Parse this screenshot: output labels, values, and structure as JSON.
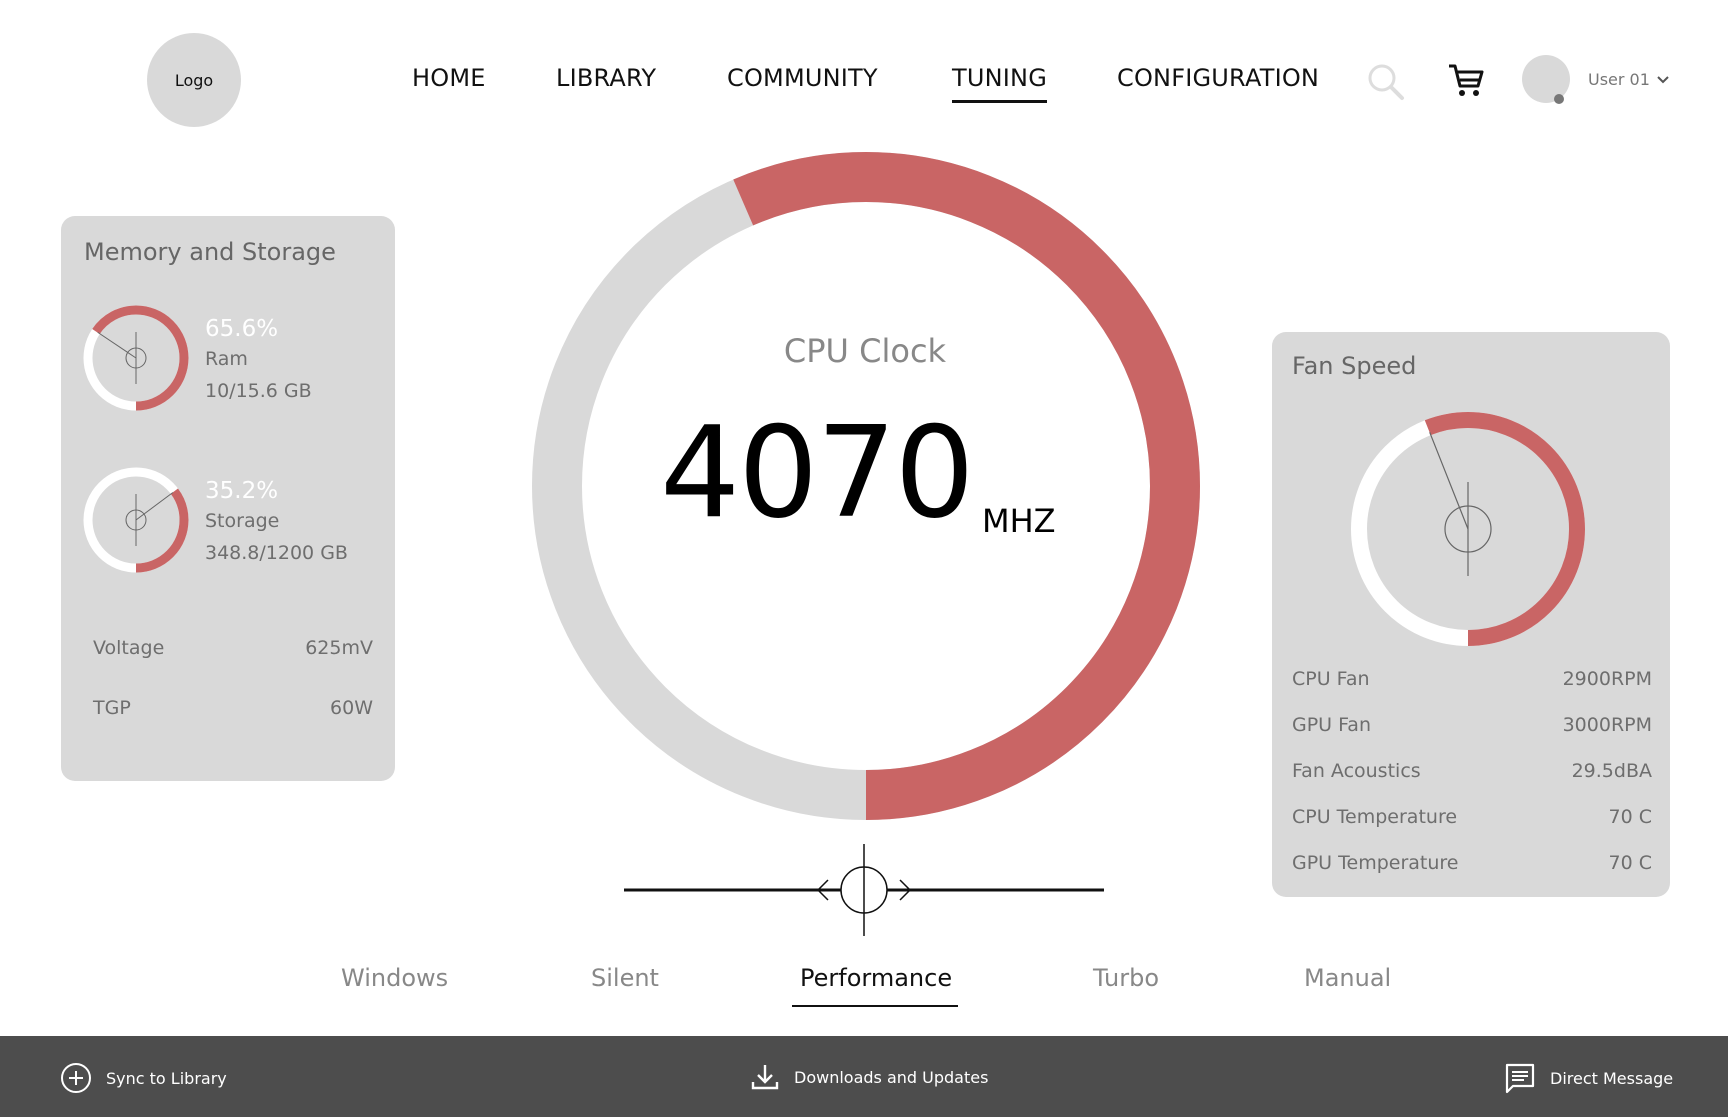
{
  "header": {
    "logo_text": "Logo",
    "nav": [
      {
        "label": "HOME"
      },
      {
        "label": "LIBRARY"
      },
      {
        "label": "COMMUNITY"
      },
      {
        "label": "TUNING"
      },
      {
        "label": "CONFIGURATION"
      }
    ],
    "active_nav": "TUNING",
    "user_name": "User 01"
  },
  "memory": {
    "title": "Memory and Storage",
    "ram": {
      "percent_text": "65.6%",
      "label": "Ram",
      "usage": "10/15.6 GB",
      "fraction": 0.656
    },
    "storage": {
      "percent_text": "35.2%",
      "label": "Storage",
      "usage": "348.8/1200 GB",
      "fraction": 0.352
    },
    "voltage": {
      "label": "Voltage",
      "value": "625mV"
    },
    "tgp": {
      "label": "TGP",
      "value": "60W"
    }
  },
  "cpu": {
    "title": "CPU Clock",
    "value": "4070",
    "unit": "MHZ",
    "fraction": 0.565
  },
  "fan": {
    "title": "Fan Speed",
    "fraction": 0.56,
    "rows": [
      {
        "label": "CPU Fan",
        "value": "2900RPM"
      },
      {
        "label": "GPU Fan",
        "value": "3000RPM"
      },
      {
        "label": "Fan Acoustics",
        "value": "29.5dBA"
      },
      {
        "label": "CPU Temperature",
        "value": "70 C"
      },
      {
        "label": "GPU Temperature",
        "value": "70 C"
      }
    ]
  },
  "modes": {
    "items": [
      {
        "label": "Windows"
      },
      {
        "label": "Silent"
      },
      {
        "label": "Performance"
      },
      {
        "label": "Turbo"
      },
      {
        "label": "Manual"
      }
    ],
    "active": "Performance"
  },
  "footer": {
    "sync_label": "Sync to Library",
    "downloads_label": "Downloads and Updates",
    "message_label": "Direct Message"
  },
  "colors": {
    "accent": "#c96565",
    "track": "#d9d9d9",
    "panel": "#d9d9d9",
    "footer": "#4d4d4d"
  }
}
